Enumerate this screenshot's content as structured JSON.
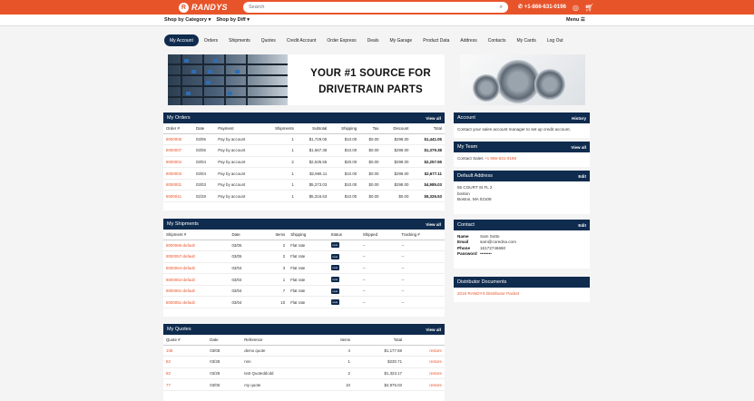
{
  "header": {
    "logo_text": "RANDYS",
    "search_placeholder": "Search",
    "phone": "+1-866-631-0196",
    "shop_category": "Shop by Category",
    "shop_diff": "Shop by Diff",
    "menu_label": "Menu"
  },
  "nav": {
    "tabs": [
      "My Account",
      "Orders",
      "Shipments",
      "Quotes",
      "Credit Account",
      "Order Express",
      "Deals",
      "My Garage",
      "Product Data",
      "Address",
      "Contacts",
      "My Cards",
      "Log Out"
    ],
    "active": "My Account"
  },
  "banner": {
    "text_line1": "YOUR #1 SOURCE FOR",
    "text_line2": "DRIVETRAIN PARTS"
  },
  "orders": {
    "title": "My Orders",
    "view_all": "View all",
    "columns": [
      "Order #",
      "Date",
      "Payment",
      "Shipments",
      "Subtotal",
      "Shipping",
      "Tax",
      "Discount",
      "Total"
    ],
    "rows": [
      [
        "8000005",
        "03/05",
        "Pay by account",
        "1",
        "$1,729.05",
        "$10.00",
        "$0.00",
        "$298.00",
        "$1,441.05"
      ],
      [
        "8000007",
        "03/05",
        "Pay by account",
        "1",
        "$1,667.38",
        "$10.00",
        "$0.00",
        "$298.00",
        "$1,379.38"
      ],
      [
        "8000004",
        "03/04",
        "Pay by account",
        "2",
        "$2,535.55",
        "$20.00",
        "$0.00",
        "$298.00",
        "$2,257.55"
      ],
      [
        "8000003",
        "03/04",
        "Pay by account",
        "1",
        "$2,965.11",
        "$10.00",
        "$0.00",
        "$298.00",
        "$2,677.11"
      ],
      [
        "8000001",
        "03/03",
        "Pay by account",
        "1",
        "$5,273.03",
        "$10.00",
        "$0.00",
        "$298.00",
        "$4,985.03"
      ],
      [
        "8000041",
        "02/28",
        "Pay by account",
        "1",
        "$5,316.53",
        "$10.00",
        "$0.00",
        "$0.00",
        "$5,326.53"
      ]
    ]
  },
  "shipments": {
    "title": "My Shipments",
    "view_all": "View all",
    "columns": [
      "Shipment #",
      "Date",
      "Items",
      "Shipping",
      "Status",
      "Shipped",
      "Tracking #"
    ],
    "rows": [
      [
        "8000066-default",
        "03/05",
        "2",
        "Flat rate",
        "new",
        "--",
        "--"
      ],
      [
        "8000057-default",
        "03/05",
        "2",
        "Flat rate",
        "new",
        "--",
        "--"
      ],
      [
        "8000064-default",
        "03/04",
        "3",
        "Flat rate",
        "new",
        "--",
        "--"
      ],
      [
        "8000054-default",
        "03/04",
        "1",
        "Flat rate",
        "new",
        "--",
        "--"
      ],
      [
        "8000061-default",
        "03/04",
        "7",
        "Flat rate",
        "new",
        "--",
        "--"
      ],
      [
        "8000051-default",
        "03/04",
        "10",
        "Flat rate",
        "new",
        "--",
        "--"
      ]
    ]
  },
  "quotes": {
    "title": "My Quotes",
    "view_all": "View all",
    "columns": [
      "Quote #",
      "Date",
      "Reference",
      "Items",
      "Total",
      ""
    ],
    "rows": [
      [
        "108",
        "03/08",
        "demo quote",
        "4",
        "$1,177.59",
        "restore"
      ],
      [
        "82",
        "03/28",
        "nnn",
        "1",
        "$230.71",
        "restore"
      ],
      [
        "82",
        "03/28",
        "test Quoteddcdd",
        "2",
        "$1,323.17",
        "restore"
      ],
      [
        "77",
        "03/05",
        "my quote",
        "10",
        "$4,975.03",
        "restore"
      ]
    ]
  },
  "account": {
    "title": "Account",
    "history": "History",
    "text": "Contact your sales account manager to set up credit account."
  },
  "team": {
    "title": "My Team",
    "view_all": "View all",
    "label": "Contact Sales",
    "phone": "+1 866-631-0196"
  },
  "address": {
    "title": "Default Address",
    "edit": "Edit",
    "line1": "55 COURT St FL 2",
    "line2": "boston",
    "line3": "Boston, MA 02108"
  },
  "contact": {
    "title": "Contact",
    "edit": "Edit",
    "name_k": "Name",
    "name_v": "Sam Sotto",
    "email_k": "Email",
    "email_v": "sam@coredna.com",
    "phone_k": "Phone",
    "phone_v": "16172746660",
    "pass_k": "Password",
    "pass_v": "••••••••"
  },
  "docs": {
    "title": "Distributor Documents",
    "link": "2016 RANDYS Distributor Packet"
  },
  "colors": {
    "brand": "#e8542a",
    "navy": "#0f2b4e"
  }
}
